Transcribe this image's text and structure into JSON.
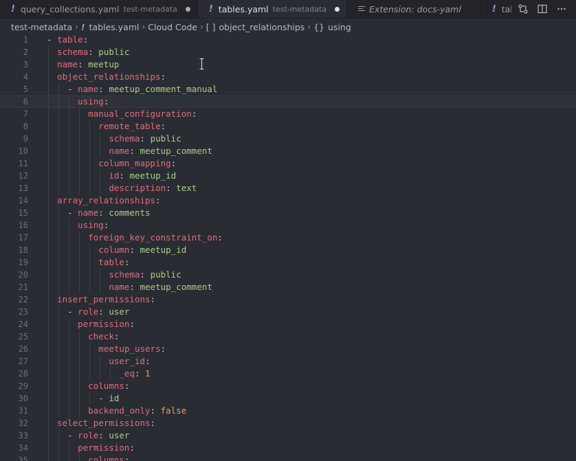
{
  "tabs": [
    {
      "name": "query_collections.yaml",
      "desc": "test-metadata",
      "modified": true,
      "active": false
    },
    {
      "name": "tables.yaml",
      "desc": "test-metadata",
      "modified": true,
      "active": true
    },
    {
      "name": "Extension: docs-yaml",
      "desc": "",
      "modified": false,
      "active": false
    },
    {
      "name": "tables.y",
      "desc": "",
      "modified": false,
      "active": false
    }
  ],
  "tab_actions": [
    "git-compare-icon",
    "split-editor-icon",
    "more-actions-icon"
  ],
  "breadcrumb": {
    "folder": "test-metadata",
    "file": "tables.yaml",
    "schema": "Cloud Code",
    "path1": "object_relationships",
    "path1_symbol": "[ ]",
    "path2": "using",
    "path2_symbol": "{}"
  },
  "editor": {
    "current_line": 6,
    "lines": [
      {
        "n": "1",
        "indent": 0,
        "dash": true,
        "key": "table",
        "val": ""
      },
      {
        "n": "2",
        "indent": 1,
        "dash": false,
        "key": "schema",
        "val": "public"
      },
      {
        "n": "3",
        "indent": 1,
        "dash": false,
        "key": "name",
        "val": "meetup"
      },
      {
        "n": "4",
        "indent": 1,
        "dash": false,
        "key": "object_relationships",
        "val": ""
      },
      {
        "n": "5",
        "indent": 2,
        "dash": true,
        "key": "name",
        "val": "meetup_comment_manual"
      },
      {
        "n": "6",
        "indent": 3,
        "dash": false,
        "key": "using",
        "val": ""
      },
      {
        "n": "7",
        "indent": 4,
        "dash": false,
        "key": "manual_configuration",
        "val": ""
      },
      {
        "n": "8",
        "indent": 5,
        "dash": false,
        "key": "remote_table",
        "val": ""
      },
      {
        "n": "9",
        "indent": 6,
        "dash": false,
        "key": "schema",
        "val": "public"
      },
      {
        "n": "10",
        "indent": 6,
        "dash": false,
        "key": "name",
        "val": "meetup_comment"
      },
      {
        "n": "11",
        "indent": 5,
        "dash": false,
        "key": "column_mapping",
        "val": ""
      },
      {
        "n": "12",
        "indent": 6,
        "dash": false,
        "key": "id",
        "val": "meetup_id"
      },
      {
        "n": "13",
        "indent": 6,
        "dash": false,
        "key": "description",
        "val": "text"
      },
      {
        "n": "14",
        "indent": 1,
        "dash": false,
        "key": "array_relationships",
        "val": ""
      },
      {
        "n": "15",
        "indent": 2,
        "dash": true,
        "key": "name",
        "val": "comments"
      },
      {
        "n": "16",
        "indent": 3,
        "dash": false,
        "key": "using",
        "val": ""
      },
      {
        "n": "17",
        "indent": 4,
        "dash": false,
        "key": "foreign_key_constraint_on",
        "val": ""
      },
      {
        "n": "18",
        "indent": 5,
        "dash": false,
        "key": "column",
        "val": "meetup_id"
      },
      {
        "n": "19",
        "indent": 5,
        "dash": false,
        "key": "table",
        "val": ""
      },
      {
        "n": "20",
        "indent": 6,
        "dash": false,
        "key": "schema",
        "val": "public"
      },
      {
        "n": "21",
        "indent": 6,
        "dash": false,
        "key": "name",
        "val": "meetup_comment"
      },
      {
        "n": "22",
        "indent": 1,
        "dash": false,
        "key": "insert_permissions",
        "val": ""
      },
      {
        "n": "23",
        "indent": 2,
        "dash": true,
        "key": "role",
        "val": "user"
      },
      {
        "n": "24",
        "indent": 3,
        "dash": false,
        "key": "permission",
        "val": ""
      },
      {
        "n": "25",
        "indent": 4,
        "dash": false,
        "key": "check",
        "val": ""
      },
      {
        "n": "26",
        "indent": 5,
        "dash": false,
        "key": "meetup_users",
        "val": ""
      },
      {
        "n": "27",
        "indent": 6,
        "dash": false,
        "key": "user_id",
        "val": ""
      },
      {
        "n": "28",
        "indent": 7,
        "dash": false,
        "key": "_eq",
        "val": "1",
        "num": true
      },
      {
        "n": "29",
        "indent": 4,
        "dash": false,
        "key": "columns",
        "val": ""
      },
      {
        "n": "30",
        "indent": 5,
        "dash": true,
        "key": "",
        "val": "id"
      },
      {
        "n": "31",
        "indent": 4,
        "dash": false,
        "key": "backend_only",
        "val": "false",
        "num": true
      },
      {
        "n": "32",
        "indent": 1,
        "dash": false,
        "key": "select_permissions",
        "val": ""
      },
      {
        "n": "33",
        "indent": 2,
        "dash": true,
        "key": "role",
        "val": "user"
      },
      {
        "n": "34",
        "indent": 3,
        "dash": false,
        "key": "permission",
        "val": ""
      },
      {
        "n": "35",
        "indent": 4,
        "dash": false,
        "key": "columns",
        "val": ""
      }
    ]
  },
  "colors": {
    "key": "#e16d7f",
    "string": "#a9d08a",
    "number": "#e7a05f",
    "background": "#2a2c33"
  }
}
